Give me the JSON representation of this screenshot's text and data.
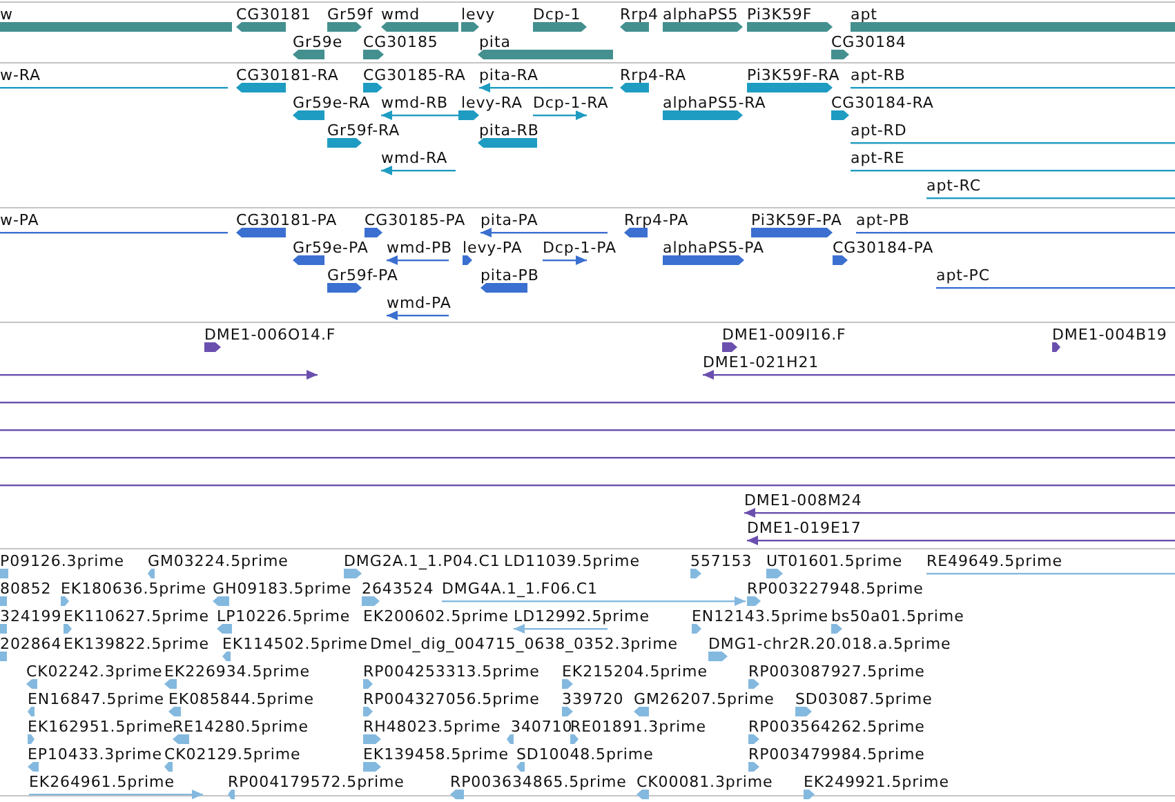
{
  "tracks": [
    {
      "color": "#43908f",
      "lanes": [
        {
          "features": [
            {
              "label": "w",
              "kind": "bar"
            },
            {
              "label": "CG30181",
              "kind": "bar"
            },
            {
              "label": "Gr59f",
              "kind": "bar"
            },
            {
              "label": "wmd",
              "kind": "bar"
            },
            {
              "label": "levy",
              "kind": "bar"
            },
            {
              "label": "Dcp-1",
              "kind": "bar"
            },
            {
              "label": "Rrp4",
              "kind": "bar"
            },
            {
              "label": "alphaPS5",
              "kind": "bar"
            },
            {
              "label": "Pi3K59F",
              "kind": "bar"
            },
            {
              "label": "apt",
              "kind": "bar"
            }
          ]
        },
        {
          "features": [
            {
              "label": "Gr59e",
              "kind": "bar"
            },
            {
              "label": "CG30185",
              "kind": "bar"
            },
            {
              "label": "pita",
              "kind": "bar"
            },
            {
              "label": "CG30184",
              "kind": "bar"
            }
          ]
        }
      ]
    },
    {
      "color": "#1e9cc2",
      "lanes": [
        {
          "features": [
            {
              "label": "w-RA",
              "kind": "line"
            },
            {
              "label": "CG30181-RA",
              "kind": "bar"
            },
            {
              "label": "CG30185-RA",
              "kind": "bar"
            },
            {
              "label": "pita-RA",
              "kind": "line"
            },
            {
              "label": "Rrp4-RA",
              "kind": "bar"
            },
            {
              "label": "Pi3K59F-RA",
              "kind": "bar"
            },
            {
              "label": "apt-RB",
              "kind": "line"
            }
          ]
        },
        {
          "features": [
            {
              "label": "Gr59e-RA",
              "kind": "bar"
            },
            {
              "label": "wmd-RB",
              "kind": "line"
            },
            {
              "label": "levy-RA",
              "kind": "bar"
            },
            {
              "label": "Dcp-1-RA",
              "kind": "line"
            },
            {
              "label": "alphaPS5-RA",
              "kind": "bar"
            },
            {
              "label": "CG30184-RA",
              "kind": "bar"
            }
          ]
        },
        {
          "features": [
            {
              "label": "Gr59f-RA",
              "kind": "bar"
            },
            {
              "label": "pita-RB",
              "kind": "bar"
            },
            {
              "label": "apt-RD",
              "kind": "line"
            }
          ]
        },
        {
          "features": [
            {
              "label": "wmd-RA",
              "kind": "line"
            },
            {
              "label": "apt-RE",
              "kind": "line"
            }
          ]
        },
        {
          "features": [
            {
              "label": "apt-RC",
              "kind": "line"
            }
          ]
        }
      ]
    },
    {
      "color": "#3b6fd0",
      "lanes": [
        {
          "features": [
            {
              "label": "w-PA",
              "kind": "line"
            },
            {
              "label": "CG30181-PA",
              "kind": "bar"
            },
            {
              "label": "CG30185-PA",
              "kind": "bar"
            },
            {
              "label": "pita-PA",
              "kind": "line"
            },
            {
              "label": "Rrp4-PA",
              "kind": "bar"
            },
            {
              "label": "Pi3K59F-PA",
              "kind": "bar"
            },
            {
              "label": "apt-PB",
              "kind": "line"
            }
          ]
        },
        {
          "features": [
            {
              "label": "Gr59e-PA",
              "kind": "bar"
            },
            {
              "label": "wmd-PB",
              "kind": "line"
            },
            {
              "label": "levy-PA",
              "kind": "bar"
            },
            {
              "label": "Dcp-1-PA",
              "kind": "line"
            },
            {
              "label": "alphaPS5-PA",
              "kind": "bar"
            },
            {
              "label": "CG30184-PA",
              "kind": "bar"
            }
          ]
        },
        {
          "features": [
            {
              "label": "Gr59f-PA",
              "kind": "bar"
            },
            {
              "label": "pita-PB",
              "kind": "bar"
            },
            {
              "label": "apt-PC",
              "kind": "line"
            }
          ]
        },
        {
          "features": [
            {
              "label": "wmd-PA",
              "kind": "line"
            }
          ]
        }
      ]
    },
    {
      "color": "#6a4fae",
      "lanes": [
        {
          "features": [
            {
              "label": "DME1-006O14.F",
              "kind": "bar"
            },
            {
              "label": "DME1-009I16.F",
              "kind": "bar"
            },
            {
              "label": "DME1-004B19",
              "kind": "bar"
            }
          ]
        },
        {
          "features": [
            {
              "kind": "line"
            },
            {
              "label": "DME1-021H21",
              "kind": "line"
            }
          ]
        },
        {
          "features": [
            {
              "kind": "line"
            }
          ]
        },
        {
          "features": [
            {
              "kind": "line"
            }
          ]
        },
        {
          "features": [
            {
              "kind": "line"
            }
          ]
        },
        {
          "features": [
            {
              "kind": "line"
            }
          ]
        },
        {
          "features": [
            {
              "label": "DME1-008M24",
              "kind": "line"
            }
          ]
        },
        {
          "features": [
            {
              "label": "DME1-019E17",
              "kind": "line"
            }
          ]
        }
      ]
    },
    {
      "color": "#84b9df",
      "lanes": [
        {
          "features": [
            {
              "label": "P09126.3prime",
              "kind": "bar"
            },
            {
              "label": "GM03224.5prime",
              "kind": "bar"
            },
            {
              "label": "DMG2A.1_1.P04.C1",
              "kind": "bar"
            },
            {
              "label": "LD11039.5prime"
            },
            {
              "label": "557153",
              "kind": "bar"
            },
            {
              "label": "UT01601.5prime",
              "kind": "bar"
            },
            {
              "label": "RE49649.5prime",
              "kind": "line"
            }
          ]
        },
        {
          "features": [
            {
              "label": "80852",
              "kind": "bar"
            },
            {
              "label": "EK180636.5prime",
              "kind": "bar"
            },
            {
              "label": "GH09183.5prime",
              "kind": "bar"
            },
            {
              "label": "2643524",
              "kind": "bar"
            },
            {
              "label": "DMG4A.1_1.F06.C1",
              "kind": "line"
            },
            {
              "label": "RP003227948.5prime",
              "kind": "bar"
            }
          ]
        },
        {
          "features": [
            {
              "label": "324199",
              "kind": "bar"
            },
            {
              "label": "EK110627.5prime",
              "kind": "bar"
            },
            {
              "label": "LP10226.5prime",
              "kind": "bar"
            },
            {
              "label": "EK200602.5prime"
            },
            {
              "label": "LD12992.5prime",
              "kind": "line"
            },
            {
              "label": "EN12143.5prime",
              "kind": "bar"
            },
            {
              "label": "bs50a01.5prime",
              "kind": "bar"
            }
          ]
        },
        {
          "features": [
            {
              "label": "202864",
              "kind": "bar"
            },
            {
              "label": "EK139822.5prime"
            },
            {
              "label": "EK114502.5prime",
              "kind": "bar"
            },
            {
              "label": "Dmel_dig_004715_0638_0352.3prime"
            },
            {
              "label": "DMG1-chr2R.20.018.a.5prime",
              "kind": "bar"
            }
          ]
        },
        {
          "features": [
            {
              "label": "CK02242.3prime",
              "kind": "bar"
            },
            {
              "label": "EK226934.5prime",
              "kind": "bar"
            },
            {
              "label": "RP004253313.5prime",
              "kind": "bar"
            },
            {
              "label": "EK215204.5prime",
              "kind": "bar"
            },
            {
              "label": "RP003087927.5prime",
              "kind": "bar"
            }
          ]
        },
        {
          "features": [
            {
              "label": "EN16847.5prime",
              "kind": "bar"
            },
            {
              "label": "EK085844.5prime",
              "kind": "bar"
            },
            {
              "label": "RP004327056.5prime",
              "kind": "bar"
            },
            {
              "label": "339720",
              "kind": "bar"
            },
            {
              "label": "GM26207.5prime",
              "kind": "bar"
            },
            {
              "label": "SD03087.5prime",
              "kind": "bar"
            }
          ]
        },
        {
          "features": [
            {
              "label": "EK162951.5prime",
              "kind": "bar"
            },
            {
              "label": "RE14280.5prime",
              "kind": "bar"
            },
            {
              "label": "RH48023.5prime",
              "kind": "bar"
            },
            {
              "label": "340710",
              "kind": "bar"
            },
            {
              "label": "RE01891.3prime",
              "kind": "bar"
            },
            {
              "label": "RP003564262.5prime",
              "kind": "bar"
            }
          ]
        },
        {
          "features": [
            {
              "label": "EP10433.3prime",
              "kind": "bar"
            },
            {
              "label": "CK02129.5prime",
              "kind": "bar"
            },
            {
              "label": "EK139458.5prime",
              "kind": "bar"
            },
            {
              "label": "SD10048.5prime",
              "kind": "bar"
            },
            {
              "label": "RP003479984.5prime",
              "kind": "bar"
            }
          ]
        },
        {
          "features": [
            {
              "label": "EK264961.5prime",
              "kind": "line"
            },
            {
              "label": "RP004179572.5prime",
              "kind": "bar"
            },
            {
              "label": "RP003634865.5prime",
              "kind": "bar"
            },
            {
              "label": "CK00081.3prime",
              "kind": "bar"
            },
            {
              "label": "EK249921.5prime",
              "kind": "bar"
            }
          ]
        }
      ]
    }
  ]
}
